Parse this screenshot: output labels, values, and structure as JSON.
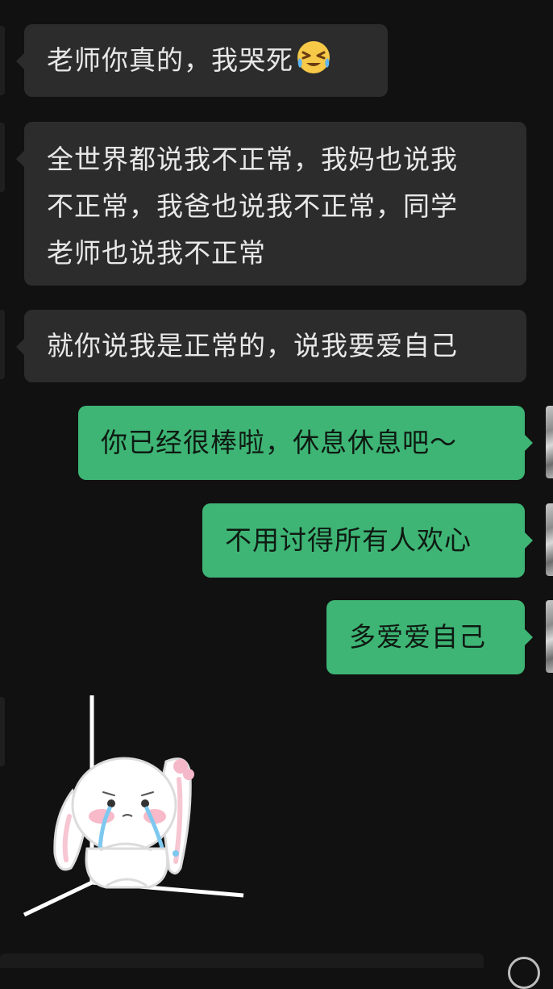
{
  "messages": [
    {
      "side": "received",
      "text": "老师你真的，我哭死",
      "emoji": "crying-laughing-face"
    },
    {
      "side": "received",
      "lines": [
        "全世界都说我不正常，我妈也说我",
        "不正常，我爸也说我不正常，同学",
        "老师也说我不正常"
      ]
    },
    {
      "side": "received",
      "text": "就你说我是正常的，说我要爱自己"
    },
    {
      "side": "sent",
      "text": "你已经很棒啦，休息休息吧～"
    },
    {
      "side": "sent",
      "text": "不用讨得所有人欢心"
    },
    {
      "side": "sent",
      "text": "多爱爱自己"
    },
    {
      "side": "received",
      "sticker": "crying-bunny-in-corner-sticker"
    }
  ],
  "colors": {
    "background": "#111111",
    "received_bubble": "#2c2c2c",
    "sent_bubble": "#3eb575"
  }
}
